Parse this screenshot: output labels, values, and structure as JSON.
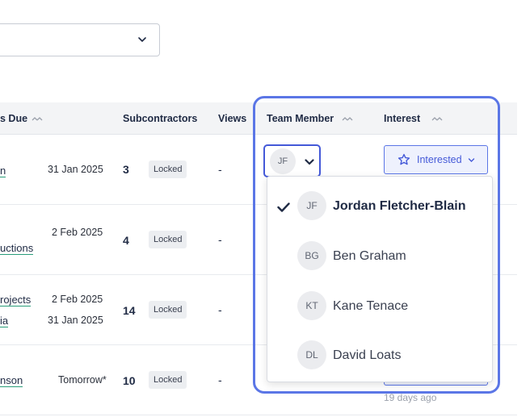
{
  "header": {
    "due": "s Due",
    "subcontractors": "Subcontractors",
    "views": "Views",
    "team_member": "Team Member",
    "interest": "Interest"
  },
  "rows": [
    {
      "links": [
        "n"
      ],
      "dates": [
        "31 Jan 2025"
      ],
      "count": "3",
      "status": "Locked",
      "views": "-"
    },
    {
      "links": [
        "uctions"
      ],
      "dates": [
        "2 Feb 2025"
      ],
      "count": "4",
      "status": "Locked",
      "views": "-"
    },
    {
      "links": [
        "rojects",
        "ia"
      ],
      "dates": [
        "2 Feb 2025",
        "31 Jan 2025"
      ],
      "count": "14",
      "status": "Locked",
      "views": "-"
    },
    {
      "links": [
        "nson"
      ],
      "dates": [
        "Tomorrow*"
      ],
      "count": "10",
      "status": "Locked",
      "views": "-"
    }
  ],
  "member_trigger": {
    "initials": "JF"
  },
  "interest_button": {
    "label": "Interested"
  },
  "last_row_interest_time": "19 days ago",
  "dropdown": {
    "options": [
      {
        "initials": "JF",
        "name": "Jordan Fletcher-Blain",
        "selected": true
      },
      {
        "initials": "BG",
        "name": "Ben Graham",
        "selected": false
      },
      {
        "initials": "KT",
        "name": "Kane Tenace",
        "selected": false
      },
      {
        "initials": "DL",
        "name": "David Loats",
        "selected": false
      }
    ]
  },
  "colors": {
    "accent": "#4459d8",
    "highlight": "#5b76e6",
    "link_underline": "#2a9d7a"
  }
}
